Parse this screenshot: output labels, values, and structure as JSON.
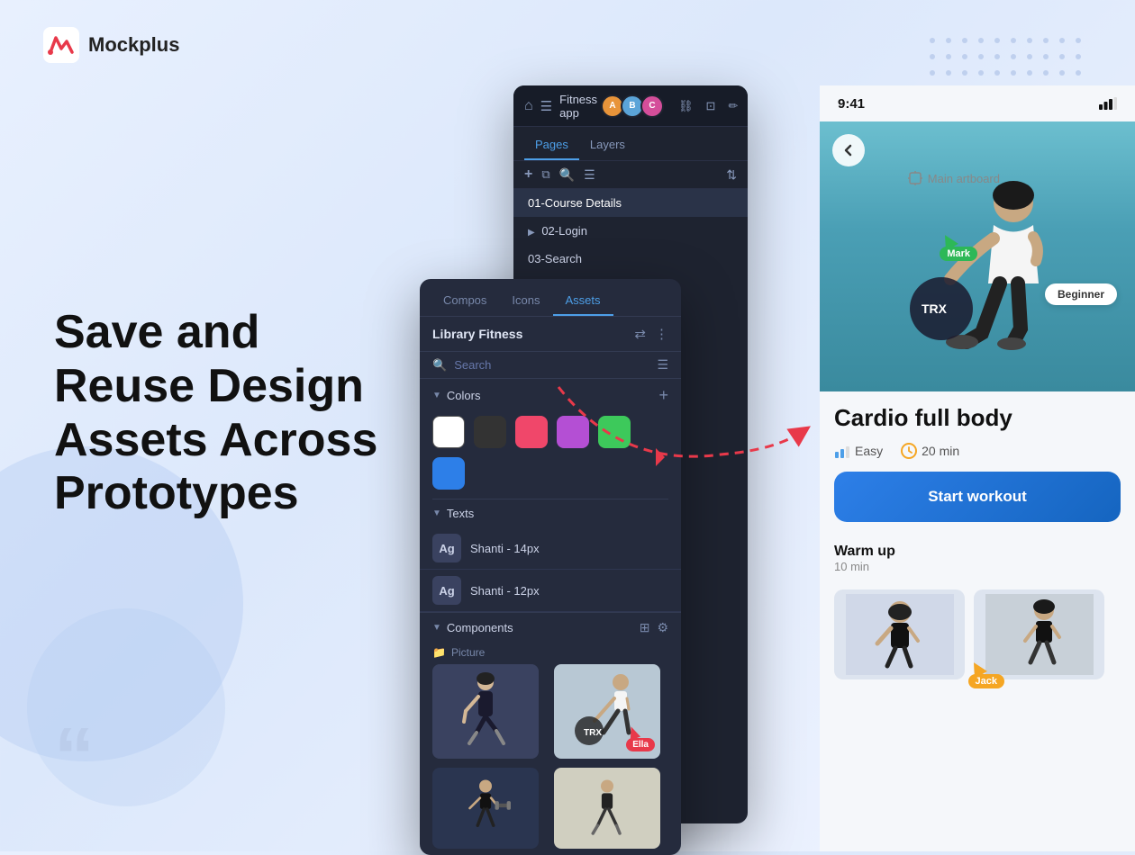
{
  "brand": {
    "logo_text": "Mockplus"
  },
  "hero": {
    "title_line1": "Save and",
    "title_line2": "Reuse Design",
    "title_line3": "Assets Across",
    "title_line4": "Prototypes"
  },
  "design_tool": {
    "app_title": "Fitness app",
    "tabs": {
      "pages_label": "Pages",
      "layers_label": "Layers"
    },
    "pages": [
      {
        "label": "01-Course Details",
        "active": true
      },
      {
        "label": "02-Login",
        "indent": false,
        "has_arrow": true
      },
      {
        "label": "03-Search",
        "indent": false
      }
    ],
    "toolbar_icons": [
      "⟳",
      "⇧",
      "✏",
      "↩",
      "↪",
      "⊡",
      "⊞"
    ]
  },
  "assets_panel": {
    "tabs": [
      "Compos",
      "Icons",
      "Assets"
    ],
    "active_tab": "Assets",
    "library_title": "Library Fitness",
    "search_placeholder": "Search",
    "sections": {
      "colors": {
        "label": "Colors",
        "swatches": [
          "#ffffff",
          "#333333",
          "#f0476a",
          "#b44fd4",
          "#3dc95b",
          "#2d7fe8"
        ]
      },
      "texts": {
        "label": "Texts",
        "items": [
          {
            "thumb": "Ag",
            "label": "Shanti - 14px"
          },
          {
            "thumb": "Ag",
            "label": "Shanti - 12px"
          }
        ]
      },
      "components": {
        "label": "Components"
      }
    }
  },
  "phone": {
    "time": "9:41",
    "workout_title": "Cardio full body",
    "beginner_badge": "Beginner",
    "meta": {
      "difficulty": "Easy",
      "duration": "20 min"
    },
    "start_workout_label": "Start workout",
    "warmup_title": "Warm up",
    "warmup_time": "10 min"
  },
  "cursors": {
    "mark_label": "Mark",
    "jack_label": "Jack",
    "ella_label": "Ella"
  },
  "artboard": {
    "label": "Main artboard"
  }
}
